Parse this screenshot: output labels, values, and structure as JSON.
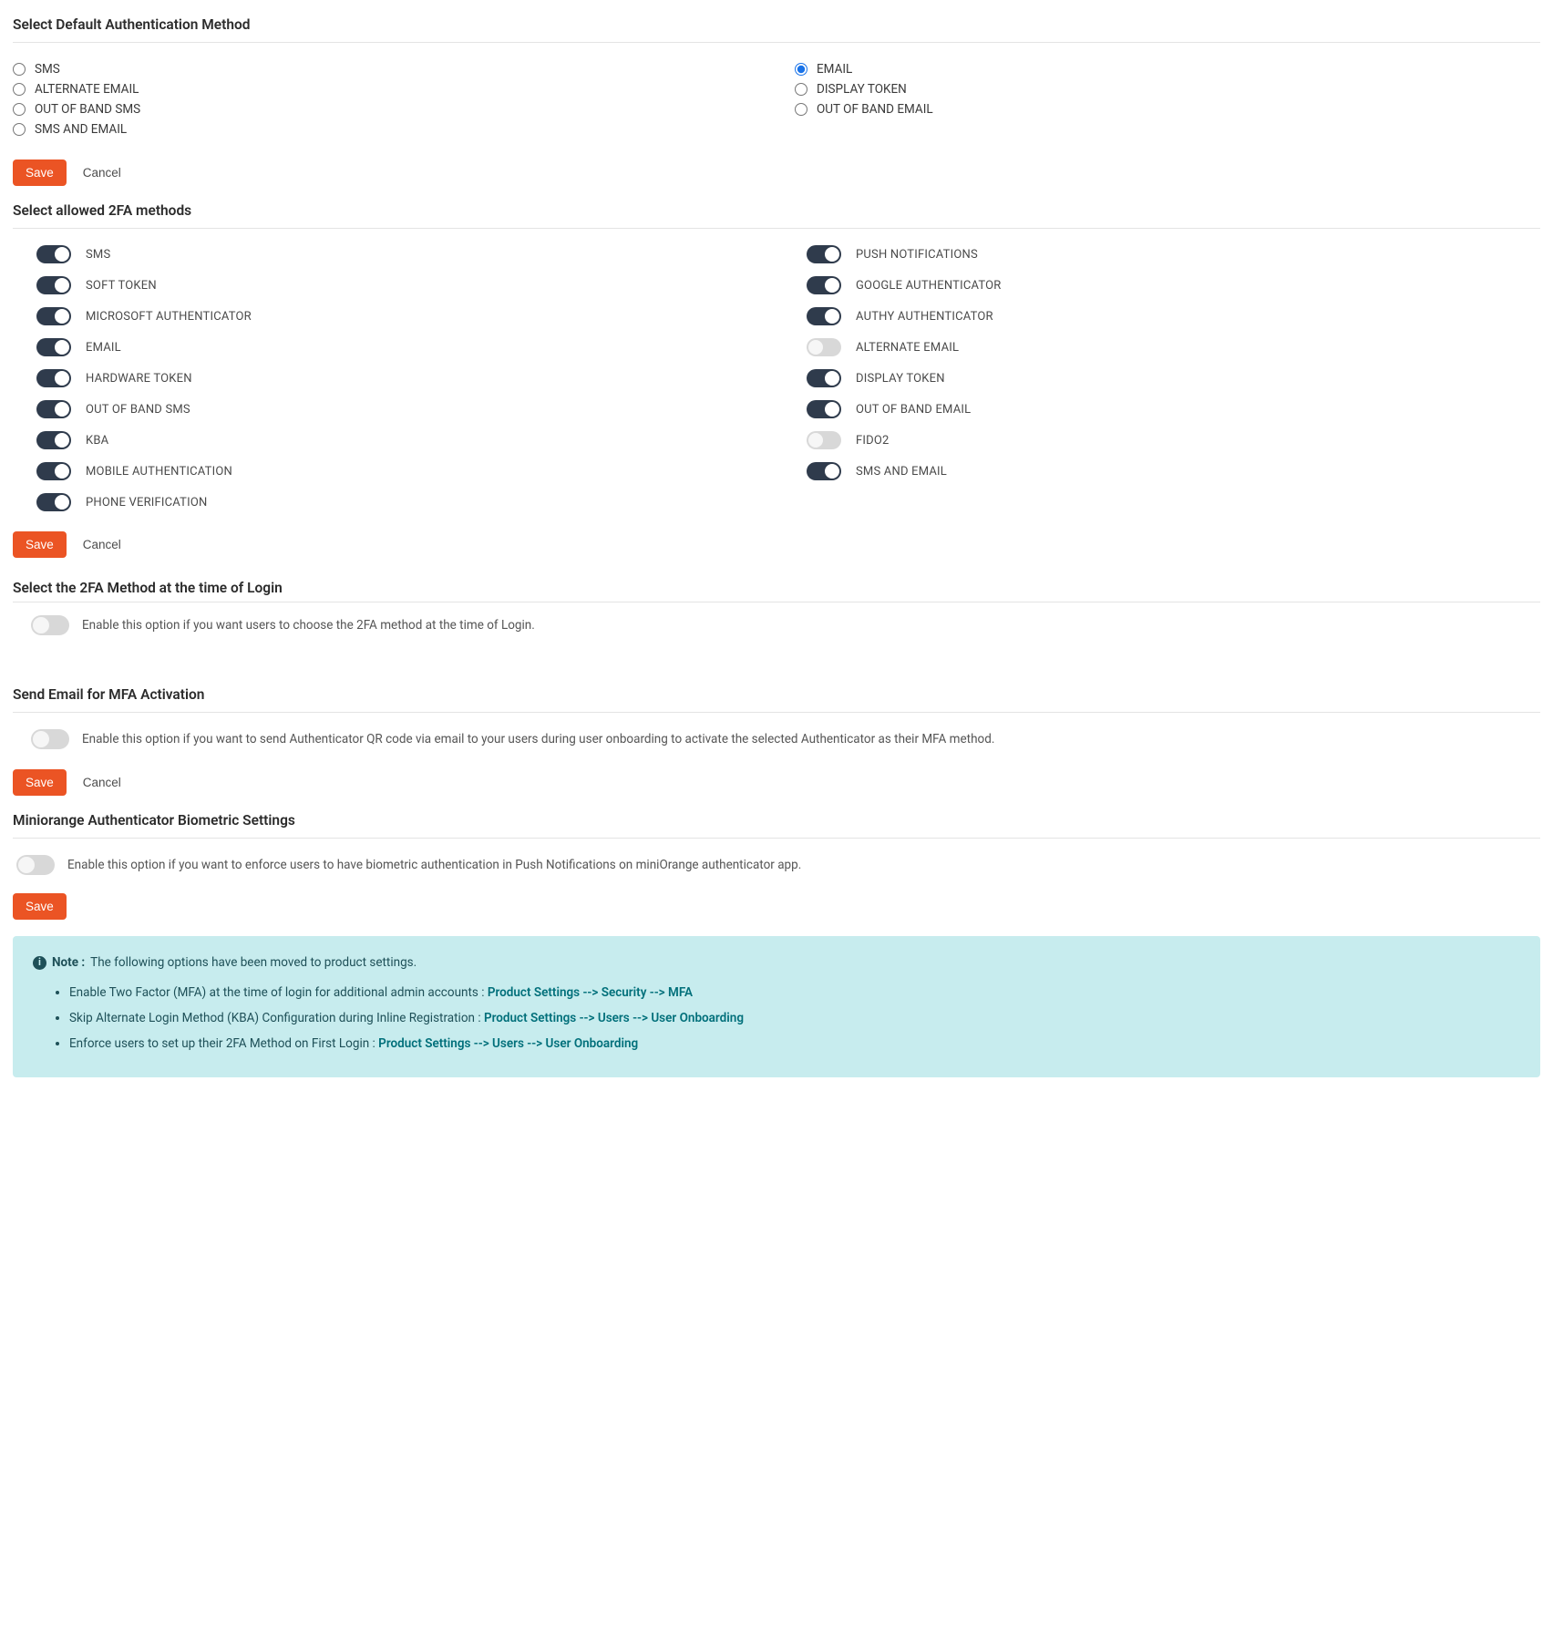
{
  "default_auth": {
    "title": "Select Default Authentication Method",
    "options_left": [
      "SMS",
      "ALTERNATE EMAIL",
      "OUT OF BAND SMS",
      "SMS AND EMAIL"
    ],
    "options_right": [
      "EMAIL",
      "DISPLAY TOKEN",
      "OUT OF BAND EMAIL"
    ],
    "selected": "EMAIL",
    "save": "Save",
    "cancel": "Cancel"
  },
  "allowed_2fa": {
    "title": "Select allowed 2FA methods",
    "left": [
      {
        "label": "SMS",
        "on": true
      },
      {
        "label": "SOFT TOKEN",
        "on": true
      },
      {
        "label": "MICROSOFT AUTHENTICATOR",
        "on": true
      },
      {
        "label": "EMAIL",
        "on": true
      },
      {
        "label": "HARDWARE TOKEN",
        "on": true
      },
      {
        "label": "OUT OF BAND SMS",
        "on": true
      },
      {
        "label": "KBA",
        "on": true
      },
      {
        "label": "MOBILE AUTHENTICATION",
        "on": true
      },
      {
        "label": "PHONE VERIFICATION",
        "on": true
      }
    ],
    "right": [
      {
        "label": "PUSH NOTIFICATIONS",
        "on": true
      },
      {
        "label": "GOOGLE AUTHENTICATOR",
        "on": true
      },
      {
        "label": "AUTHY AUTHENTICATOR",
        "on": true
      },
      {
        "label": "ALTERNATE EMAIL",
        "on": false
      },
      {
        "label": "DISPLAY TOKEN",
        "on": true
      },
      {
        "label": "OUT OF BAND EMAIL",
        "on": true
      },
      {
        "label": "FIDO2",
        "on": false
      },
      {
        "label": "SMS AND EMAIL",
        "on": true
      }
    ],
    "save": "Save",
    "cancel": "Cancel"
  },
  "select_2fa_login": {
    "title": "Select the 2FA Method at the time of Login",
    "text": "Enable this option if you want users to choose the 2FA method at the time of Login.",
    "on": false
  },
  "send_email_mfa": {
    "title": "Send Email for MFA Activation",
    "text": "Enable this option if you want to send Authenticator QR code via email to your users during user onboarding to activate the selected Authenticator as their MFA method.",
    "on": false,
    "save": "Save",
    "cancel": "Cancel"
  },
  "biometric": {
    "title": "Miniorange Authenticator Biometric Settings",
    "text": "Enable this option if you want to enforce users to have biometric authentication in Push Notifications on miniOrange authenticator app.",
    "on": false,
    "save": "Save"
  },
  "notice": {
    "note_label": "Note :",
    "intro": "The following options have been moved to product settings.",
    "items": [
      {
        "text": "Enable Two Factor (MFA) at the time of login for additional admin accounts : ",
        "link": "Product Settings --> Security --> MFA"
      },
      {
        "text": "Skip Alternate Login Method (KBA) Configuration during Inline Registration : ",
        "link": "Product Settings --> Users --> User Onboarding"
      },
      {
        "text": "Enforce users to set up their 2FA Method on First Login : ",
        "link": "Product Settings --> Users --> User Onboarding"
      }
    ]
  }
}
